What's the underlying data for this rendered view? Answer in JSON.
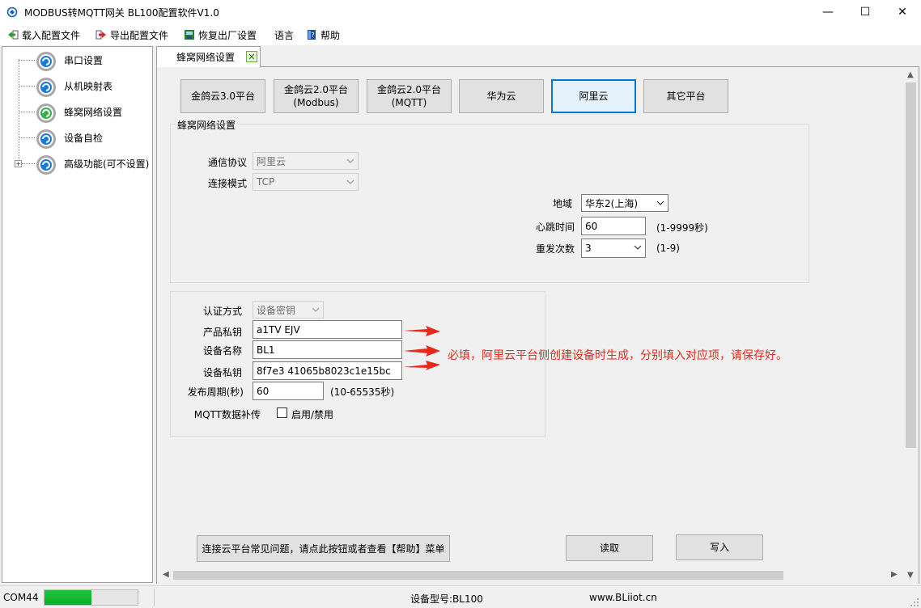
{
  "window": {
    "title": "MODBUS转MQTT网关 BL100配置软件V1.0",
    "minimize_glyph": "—",
    "maximize_glyph": "☐",
    "close_glyph": "✕"
  },
  "menu": {
    "items": [
      {
        "label": "载入配置文件",
        "icon": "import-arrow-icon"
      },
      {
        "label": "导出配置文件",
        "icon": "export-arrow-icon"
      },
      {
        "label": "恢复出厂设置",
        "icon": "factory-reset-icon"
      },
      {
        "label": "语言",
        "icon": ""
      },
      {
        "label": "帮助",
        "icon": "help-book-icon"
      }
    ]
  },
  "tree": {
    "items": [
      {
        "label": "串口设置"
      },
      {
        "label": "从机映射表"
      },
      {
        "label": "蜂窝网络设置",
        "selected": true
      },
      {
        "label": "设备自检"
      },
      {
        "label": "高级功能(可不设置)",
        "expander": "+"
      }
    ]
  },
  "tab": {
    "label": "蜂窝网络设置",
    "close_glyph": "✕"
  },
  "platforms": [
    {
      "label": "金鸽云3.0平台"
    },
    {
      "label": "金鸽云2.0平台\n(Modbus)"
    },
    {
      "label": "金鸽云2.0平台\n(MQTT)"
    },
    {
      "label": "华为云"
    },
    {
      "label": "阿里云",
      "selected": true
    },
    {
      "label": "其它平台"
    }
  ],
  "cellular": {
    "group_title": "蜂窝网络设置",
    "protocol_label": "通信协议",
    "protocol_value": "阿里云",
    "mode_label": "连接模式",
    "mode_value": "TCP",
    "region_label": "地域",
    "region_value": "华东2(上海)",
    "heartbeat_label": "心跳时间",
    "heartbeat_value": "60",
    "heartbeat_hint": "(1-9999秒)",
    "retry_label": "重发次数",
    "retry_value": "3",
    "retry_hint": "(1-9)"
  },
  "auth": {
    "method_label": "认证方式",
    "method_value": "设备密钥",
    "product_key_label": "产品私钥",
    "product_key_value": "a1TV    EJV",
    "device_name_label": "设备名称",
    "device_name_value": "BL1",
    "device_secret_label": "设备私钥",
    "device_secret_value": "8f7e3      41065b8023c1e15bc",
    "publish_label": "发布周期(秒)",
    "publish_value": "60",
    "publish_hint": "(10-65535秒)",
    "mqtt_label": "MQTT数据补传",
    "mqtt_checkbox_label": "启用/禁用",
    "mqtt_checked": false
  },
  "annotation": {
    "text": "必填，阿里云平台侧创建设备时生成，分别填入对应项，请保存好。",
    "color": "#e8281b"
  },
  "bottom": {
    "faq_button": "连接云平台常见问题，请点此按钮或者查看【帮助】菜单",
    "read_button": "读取",
    "write_button": "写入"
  },
  "status": {
    "port": "COM44",
    "progress": 0.5,
    "model": "设备型号:BL100",
    "website": "www.BLiiot.cn"
  },
  "colors": {
    "accent": "#0078d7",
    "progress": "#06b025"
  }
}
